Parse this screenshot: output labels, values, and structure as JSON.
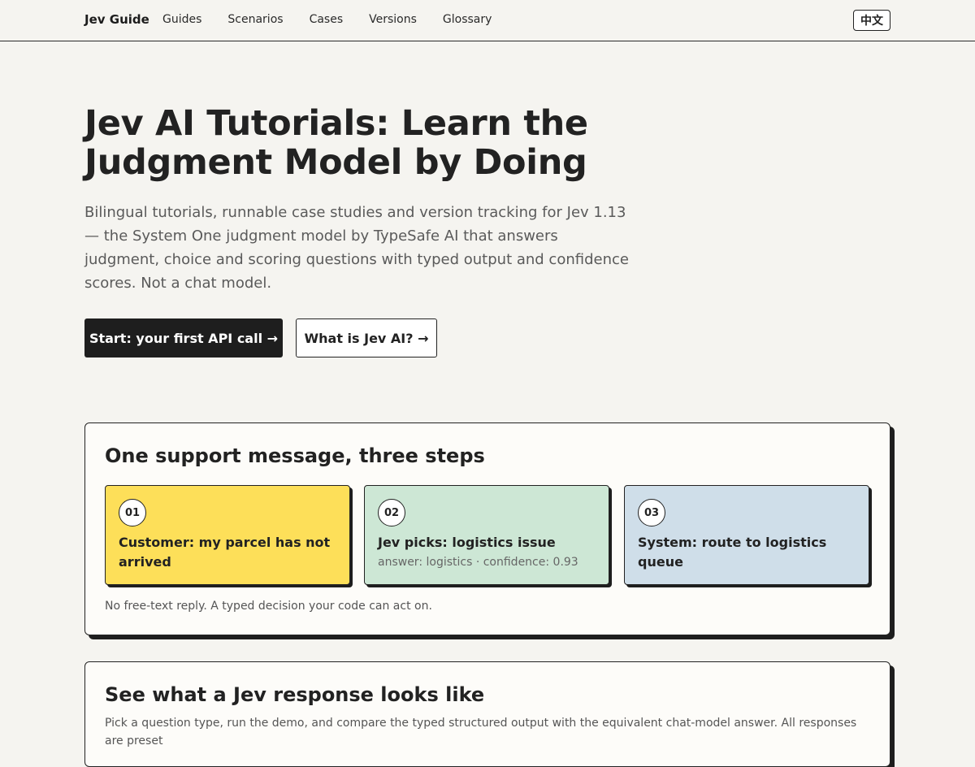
{
  "nav": {
    "brand": "Jev Guide",
    "links": [
      "Guides",
      "Scenarios",
      "Cases",
      "Versions",
      "Glossary"
    ],
    "lang_label": "中文"
  },
  "hero": {
    "title": "Jev AI Tutorials: Learn the Judgment Model by Doing",
    "subtitle": "Bilingual tutorials, runnable case studies and version tracking for Jev 1.13 — the System One judgment model by TypeSafe AI that answers judgment, choice and scoring questions with typed output and confidence scores. Not a chat model.",
    "primary_button": "Start: your first API call →",
    "secondary_button": "What is Jev AI? →"
  },
  "steps_card": {
    "title": "One support message, three steps",
    "steps": [
      {
        "num": "01",
        "text": "Customer: my parcel has not arrived",
        "meta": "",
        "color": "#fddf59"
      },
      {
        "num": "02",
        "text": "Jev picks: logistics issue",
        "meta": "answer: logistics · confidence: 0.93",
        "color": "#cde7d5"
      },
      {
        "num": "03",
        "text": "System: route to logistics queue",
        "meta": "",
        "color": "#cfdee9"
      }
    ],
    "note": "No free-text reply. A typed decision your code can act on."
  },
  "demo_card": {
    "title": "See what a Jev response looks like",
    "description": "Pick a question type, run the demo, and compare the typed structured output with the equivalent chat-model answer. All responses are preset"
  }
}
